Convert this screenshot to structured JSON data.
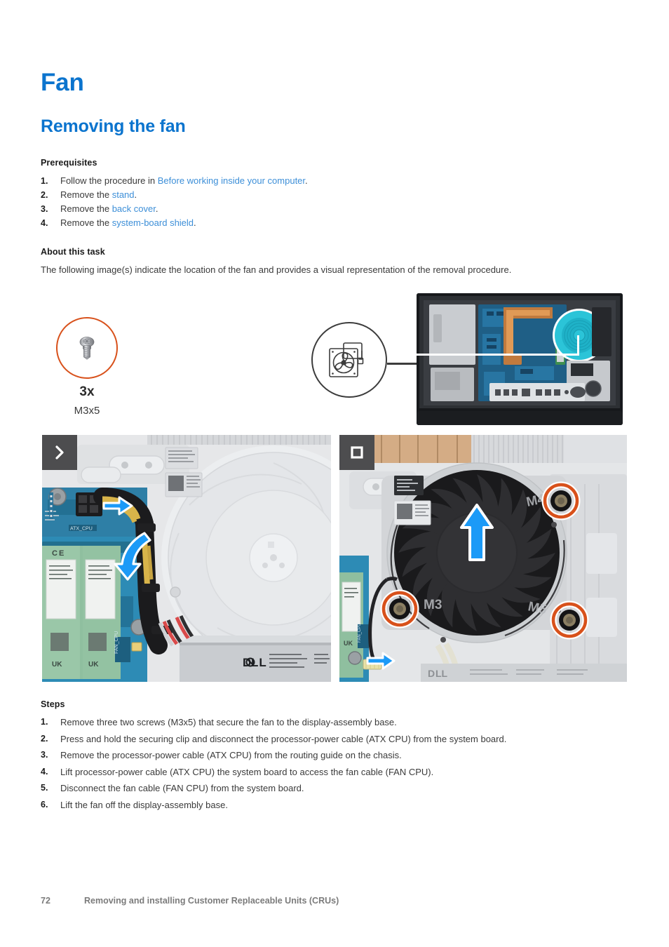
{
  "document": {
    "chapter_title": "Fan",
    "section_title": "Removing the fan"
  },
  "prerequisites": {
    "heading": "Prerequisites",
    "items": [
      {
        "num": "1.",
        "pre": "Follow the procedure in ",
        "link": "Before working inside your computer",
        "post": "."
      },
      {
        "num": "2.",
        "pre": "Remove the ",
        "link": "stand",
        "post": "."
      },
      {
        "num": "3.",
        "pre": "Remove the ",
        "link": "back cover",
        "post": "."
      },
      {
        "num": "4.",
        "pre": "Remove the ",
        "link": "system-board shield",
        "post": "."
      }
    ]
  },
  "about_this_task": {
    "heading": "About this task",
    "text": "The following image(s) indicate the location of the fan and provides a visual representation of the removal procedure."
  },
  "figure": {
    "screw_callout": {
      "quantity": "3x",
      "spec": "M3x5",
      "icon": "screw-icon",
      "ring_color": "#d8511b"
    },
    "fan_callout": {
      "icon": "fan-icon",
      "ring_color": "#3c3c3c"
    },
    "board_photo": {
      "name": "all-in-one-chassis-photo",
      "highlight_color": "#2bc4d8",
      "highlight_label": "fan-location-highlight"
    },
    "panels": [
      {
        "badge": "chevron-right-icon",
        "name": "fan-cable-disconnect-photo"
      },
      {
        "badge": "square-icon",
        "name": "fan-screws-removal-photo"
      }
    ],
    "badge_color": "#4d4d4f",
    "screw_ring_color": "#d8511b",
    "arrow_color": "#1b9af7"
  },
  "steps": {
    "heading": "Steps",
    "items": [
      {
        "num": "1.",
        "text": "Remove three two screws (M3x5) that secure the fan to the display-assembly base."
      },
      {
        "num": "2.",
        "text": "Press and hold the securing clip and disconnect the processor-power cable (ATX CPU) from the system board."
      },
      {
        "num": "3.",
        "text": "Remove the processor-power cable (ATX CPU) from the routing guide on the chasis."
      },
      {
        "num": "4.",
        "text": "Lift processor-power cable (ATX CPU) the system board to access the fan cable (FAN CPU)."
      },
      {
        "num": "5.",
        "text": "Disconnect the fan cable (FAN CPU) from the system board."
      },
      {
        "num": "6.",
        "text": "Lift the fan off the display-assembly base."
      }
    ]
  },
  "footer": {
    "page_number": "72",
    "title": "Removing and installing Customer Replaceable Units (CRUs)"
  },
  "brand": {
    "heading_color": "#0b74ce",
    "link_color": "#3d8fd8",
    "logo_text": "D∆LL"
  }
}
